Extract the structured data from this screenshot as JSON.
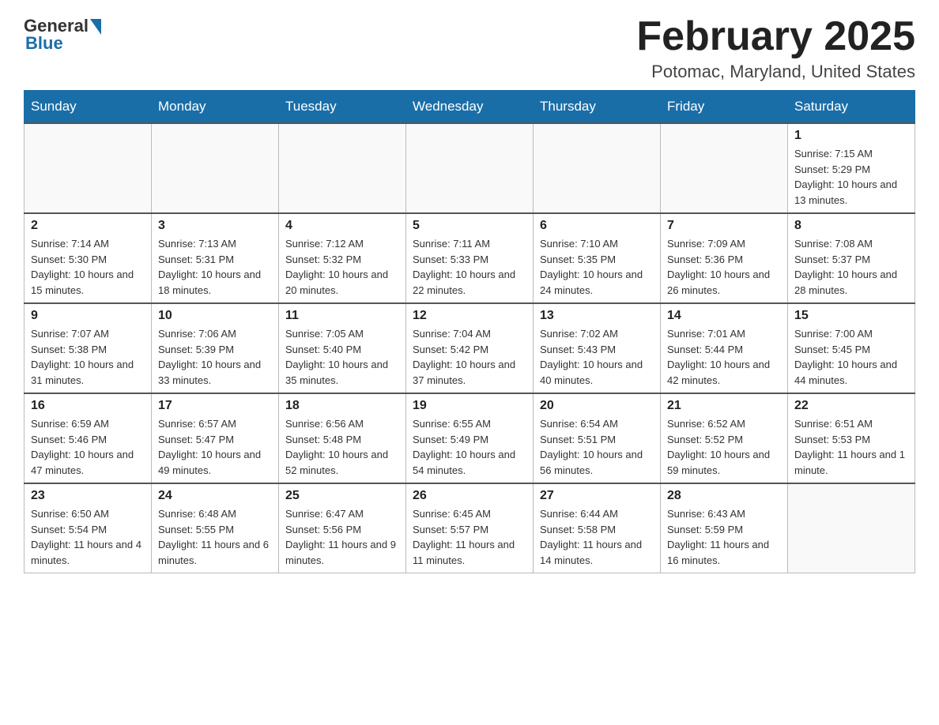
{
  "header": {
    "logo": {
      "general": "General",
      "blue": "Blue"
    },
    "title": "February 2025",
    "location": "Potomac, Maryland, United States"
  },
  "days_of_week": [
    "Sunday",
    "Monday",
    "Tuesday",
    "Wednesday",
    "Thursday",
    "Friday",
    "Saturday"
  ],
  "weeks": [
    [
      {
        "day": "",
        "info": ""
      },
      {
        "day": "",
        "info": ""
      },
      {
        "day": "",
        "info": ""
      },
      {
        "day": "",
        "info": ""
      },
      {
        "day": "",
        "info": ""
      },
      {
        "day": "",
        "info": ""
      },
      {
        "day": "1",
        "info": "Sunrise: 7:15 AM\nSunset: 5:29 PM\nDaylight: 10 hours and 13 minutes."
      }
    ],
    [
      {
        "day": "2",
        "info": "Sunrise: 7:14 AM\nSunset: 5:30 PM\nDaylight: 10 hours and 15 minutes."
      },
      {
        "day": "3",
        "info": "Sunrise: 7:13 AM\nSunset: 5:31 PM\nDaylight: 10 hours and 18 minutes."
      },
      {
        "day": "4",
        "info": "Sunrise: 7:12 AM\nSunset: 5:32 PM\nDaylight: 10 hours and 20 minutes."
      },
      {
        "day": "5",
        "info": "Sunrise: 7:11 AM\nSunset: 5:33 PM\nDaylight: 10 hours and 22 minutes."
      },
      {
        "day": "6",
        "info": "Sunrise: 7:10 AM\nSunset: 5:35 PM\nDaylight: 10 hours and 24 minutes."
      },
      {
        "day": "7",
        "info": "Sunrise: 7:09 AM\nSunset: 5:36 PM\nDaylight: 10 hours and 26 minutes."
      },
      {
        "day": "8",
        "info": "Sunrise: 7:08 AM\nSunset: 5:37 PM\nDaylight: 10 hours and 28 minutes."
      }
    ],
    [
      {
        "day": "9",
        "info": "Sunrise: 7:07 AM\nSunset: 5:38 PM\nDaylight: 10 hours and 31 minutes."
      },
      {
        "day": "10",
        "info": "Sunrise: 7:06 AM\nSunset: 5:39 PM\nDaylight: 10 hours and 33 minutes."
      },
      {
        "day": "11",
        "info": "Sunrise: 7:05 AM\nSunset: 5:40 PM\nDaylight: 10 hours and 35 minutes."
      },
      {
        "day": "12",
        "info": "Sunrise: 7:04 AM\nSunset: 5:42 PM\nDaylight: 10 hours and 37 minutes."
      },
      {
        "day": "13",
        "info": "Sunrise: 7:02 AM\nSunset: 5:43 PM\nDaylight: 10 hours and 40 minutes."
      },
      {
        "day": "14",
        "info": "Sunrise: 7:01 AM\nSunset: 5:44 PM\nDaylight: 10 hours and 42 minutes."
      },
      {
        "day": "15",
        "info": "Sunrise: 7:00 AM\nSunset: 5:45 PM\nDaylight: 10 hours and 44 minutes."
      }
    ],
    [
      {
        "day": "16",
        "info": "Sunrise: 6:59 AM\nSunset: 5:46 PM\nDaylight: 10 hours and 47 minutes."
      },
      {
        "day": "17",
        "info": "Sunrise: 6:57 AM\nSunset: 5:47 PM\nDaylight: 10 hours and 49 minutes."
      },
      {
        "day": "18",
        "info": "Sunrise: 6:56 AM\nSunset: 5:48 PM\nDaylight: 10 hours and 52 minutes."
      },
      {
        "day": "19",
        "info": "Sunrise: 6:55 AM\nSunset: 5:49 PM\nDaylight: 10 hours and 54 minutes."
      },
      {
        "day": "20",
        "info": "Sunrise: 6:54 AM\nSunset: 5:51 PM\nDaylight: 10 hours and 56 minutes."
      },
      {
        "day": "21",
        "info": "Sunrise: 6:52 AM\nSunset: 5:52 PM\nDaylight: 10 hours and 59 minutes."
      },
      {
        "day": "22",
        "info": "Sunrise: 6:51 AM\nSunset: 5:53 PM\nDaylight: 11 hours and 1 minute."
      }
    ],
    [
      {
        "day": "23",
        "info": "Sunrise: 6:50 AM\nSunset: 5:54 PM\nDaylight: 11 hours and 4 minutes."
      },
      {
        "day": "24",
        "info": "Sunrise: 6:48 AM\nSunset: 5:55 PM\nDaylight: 11 hours and 6 minutes."
      },
      {
        "day": "25",
        "info": "Sunrise: 6:47 AM\nSunset: 5:56 PM\nDaylight: 11 hours and 9 minutes."
      },
      {
        "day": "26",
        "info": "Sunrise: 6:45 AM\nSunset: 5:57 PM\nDaylight: 11 hours and 11 minutes."
      },
      {
        "day": "27",
        "info": "Sunrise: 6:44 AM\nSunset: 5:58 PM\nDaylight: 11 hours and 14 minutes."
      },
      {
        "day": "28",
        "info": "Sunrise: 6:43 AM\nSunset: 5:59 PM\nDaylight: 11 hours and 16 minutes."
      },
      {
        "day": "",
        "info": ""
      }
    ]
  ]
}
